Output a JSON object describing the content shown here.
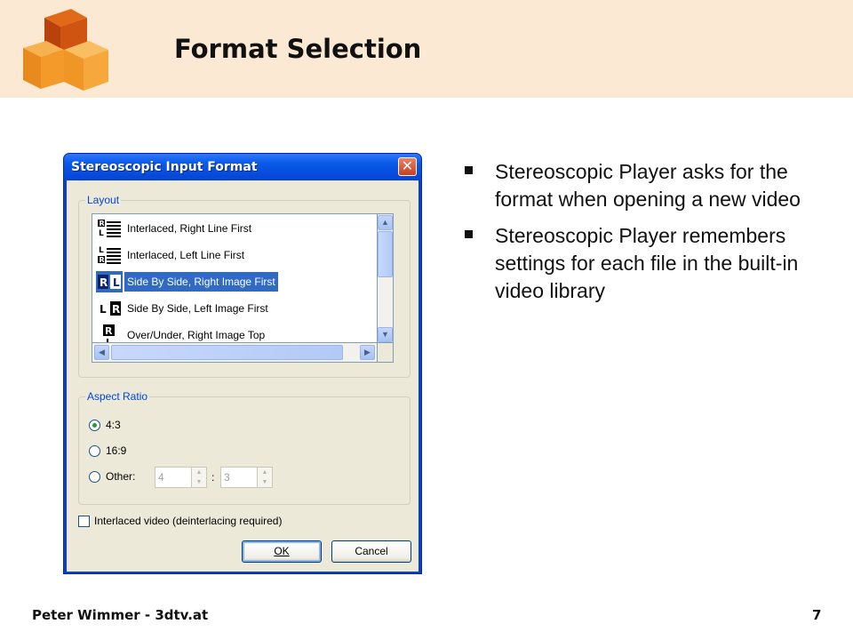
{
  "slide": {
    "title": "Format Selection",
    "bullets": [
      "Stereoscopic Player asks for the format when opening a new video",
      "Stereoscopic Player remembers settings for each file in the built-in video library"
    ],
    "footer_left": "Peter Wimmer - 3dtv.at",
    "page_number": "7",
    "colors": {
      "header_band": "#fbe9d4",
      "logo_orange": "#f39a2b",
      "logo_dark": "#c9500e"
    }
  },
  "dialog": {
    "title": "Stereoscopic Input Format",
    "close_glyph": "✕",
    "layout": {
      "legend": "Layout",
      "items": [
        {
          "label": "Interlaced, Right Line First",
          "icon": "interlaced-right-first-icon",
          "selected": false
        },
        {
          "label": "Interlaced, Left Line First",
          "icon": "interlaced-left-first-icon",
          "selected": false
        },
        {
          "label": "Side By Side, Right Image First",
          "icon": "side-by-side-right-first-icon",
          "selected": true
        },
        {
          "label": "Side By Side, Left Image First",
          "icon": "side-by-side-left-first-icon",
          "selected": false
        },
        {
          "label": "Over/Under, Right Image Top",
          "icon": "over-under-right-top-icon",
          "selected": false
        }
      ]
    },
    "aspect_ratio": {
      "legend": "Aspect Ratio",
      "options": [
        {
          "label": "4:3",
          "checked": true
        },
        {
          "label": "16:9",
          "checked": false
        },
        {
          "label": "Other:",
          "checked": false
        }
      ],
      "other_width": "4",
      "other_height": "3",
      "separator": ":"
    },
    "interlaced_checkbox": {
      "label": "Interlaced video (deinterlacing required)",
      "checked": false
    },
    "ok_label": "OK",
    "cancel_label": "Cancel"
  }
}
